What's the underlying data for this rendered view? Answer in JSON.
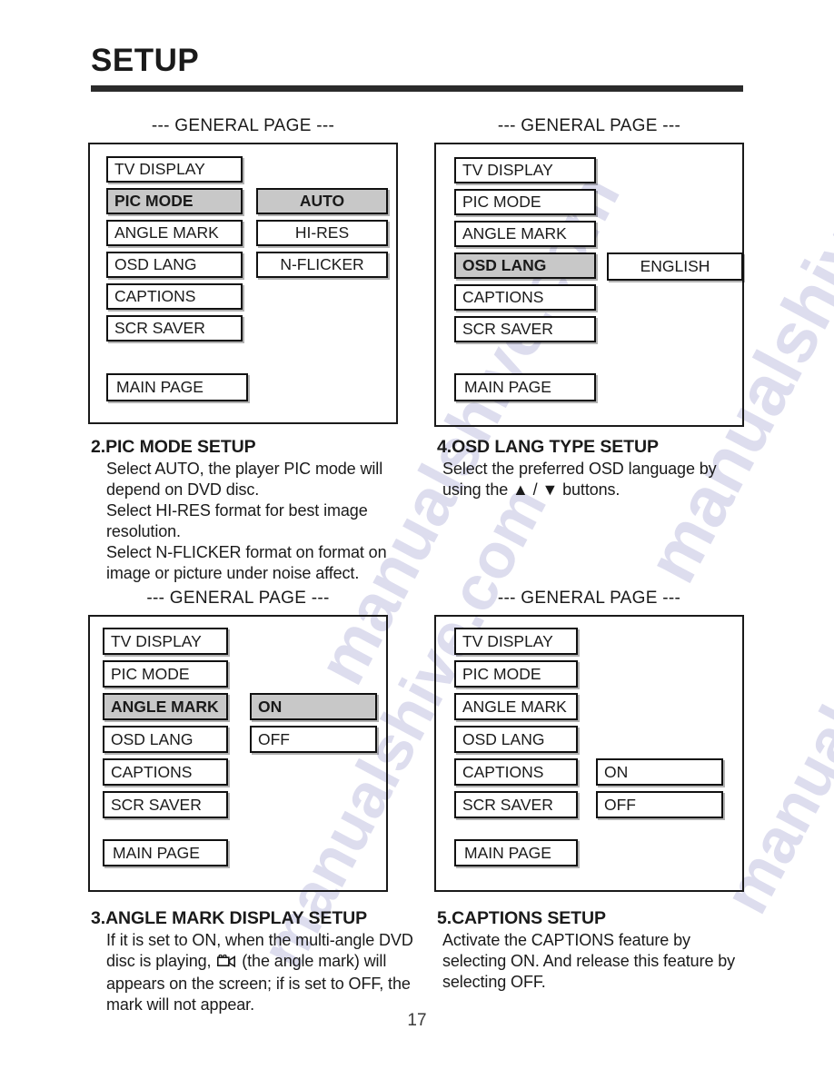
{
  "header": {
    "title": "SETUP"
  },
  "page_number": "17",
  "watermark_text": "manualshive.com",
  "colors": {
    "selected_fill": "#c8c8c8",
    "ink": "#1a1a1a",
    "rule": "#2b2b2b"
  },
  "panels": [
    {
      "caption": "--- GENERAL PAGE ---",
      "menu": [
        {
          "label": "TV DISPLAY",
          "selected": false
        },
        {
          "label": "PIC MODE",
          "selected": true
        },
        {
          "label": "ANGLE MARK",
          "selected": false
        },
        {
          "label": "OSD LANG",
          "selected": false
        },
        {
          "label": "CAPTIONS",
          "selected": false
        },
        {
          "label": "SCR SAVER",
          "selected": false
        }
      ],
      "options": [
        {
          "label": "AUTO",
          "selected": true
        },
        {
          "label": "HI-RES",
          "selected": false
        },
        {
          "label": "N-FLICKER",
          "selected": false
        }
      ],
      "main_page_label": "MAIN PAGE"
    },
    {
      "caption": "--- GENERAL PAGE ---",
      "menu": [
        {
          "label": "TV DISPLAY",
          "selected": false
        },
        {
          "label": "PIC MODE",
          "selected": false
        },
        {
          "label": "ANGLE MARK",
          "selected": false
        },
        {
          "label": "OSD LANG",
          "selected": true
        },
        {
          "label": "CAPTIONS",
          "selected": false
        },
        {
          "label": "SCR SAVER",
          "selected": false
        }
      ],
      "options": [
        {
          "label": "ENGLISH",
          "selected": false
        }
      ],
      "main_page_label": "MAIN PAGE"
    },
    {
      "caption": "--- GENERAL PAGE ---",
      "menu": [
        {
          "label": "TV DISPLAY",
          "selected": false
        },
        {
          "label": "PIC MODE",
          "selected": false
        },
        {
          "label": "ANGLE MARK",
          "selected": true
        },
        {
          "label": "OSD LANG",
          "selected": false
        },
        {
          "label": "CAPTIONS",
          "selected": false
        },
        {
          "label": "SCR SAVER",
          "selected": false
        }
      ],
      "options": [
        {
          "label": "ON",
          "selected": true
        },
        {
          "label": "OFF",
          "selected": false
        }
      ],
      "main_page_label": "MAIN PAGE"
    },
    {
      "caption": "--- GENERAL PAGE ---",
      "menu": [
        {
          "label": "TV DISPLAY",
          "selected": false
        },
        {
          "label": "PIC MODE",
          "selected": false
        },
        {
          "label": "ANGLE MARK",
          "selected": false
        },
        {
          "label": "OSD LANG",
          "selected": false
        },
        {
          "label": "CAPTIONS",
          "selected": false
        },
        {
          "label": "SCR SAVER",
          "selected": false
        }
      ],
      "options": [
        {
          "label": "ON",
          "selected": false
        },
        {
          "label": "OFF",
          "selected": false
        }
      ],
      "main_page_label": "MAIN PAGE"
    }
  ],
  "sections": {
    "pic_mode": {
      "heading": "2.PIC MODE SETUP",
      "body": "Select AUTO, the player PIC mode will depend on DVD disc.\nSelect HI-RES format for best image resolution.\nSelect N-FLICKER format on format on image or picture under noise affect."
    },
    "osd_lang": {
      "heading": "4.OSD LANG TYPE SETUP",
      "body": "Select the preferred OSD language by using the ▲ / ▼ buttons."
    },
    "angle_mark": {
      "heading": "3.ANGLE MARK DISPLAY SETUP",
      "body_before_icon": "If it is set to ON, when the multi-angle DVD disc is playing,",
      "icon_name": "angle-mark-camera-icon",
      "body_after_icon": "(the angle mark) will appears on the screen; if is set to OFF, the mark will not appear."
    },
    "captions": {
      "heading": "5.CAPTIONS SETUP",
      "body": "Activate the CAPTIONS feature by selecting ON.  And release this feature by selecting OFF."
    }
  }
}
